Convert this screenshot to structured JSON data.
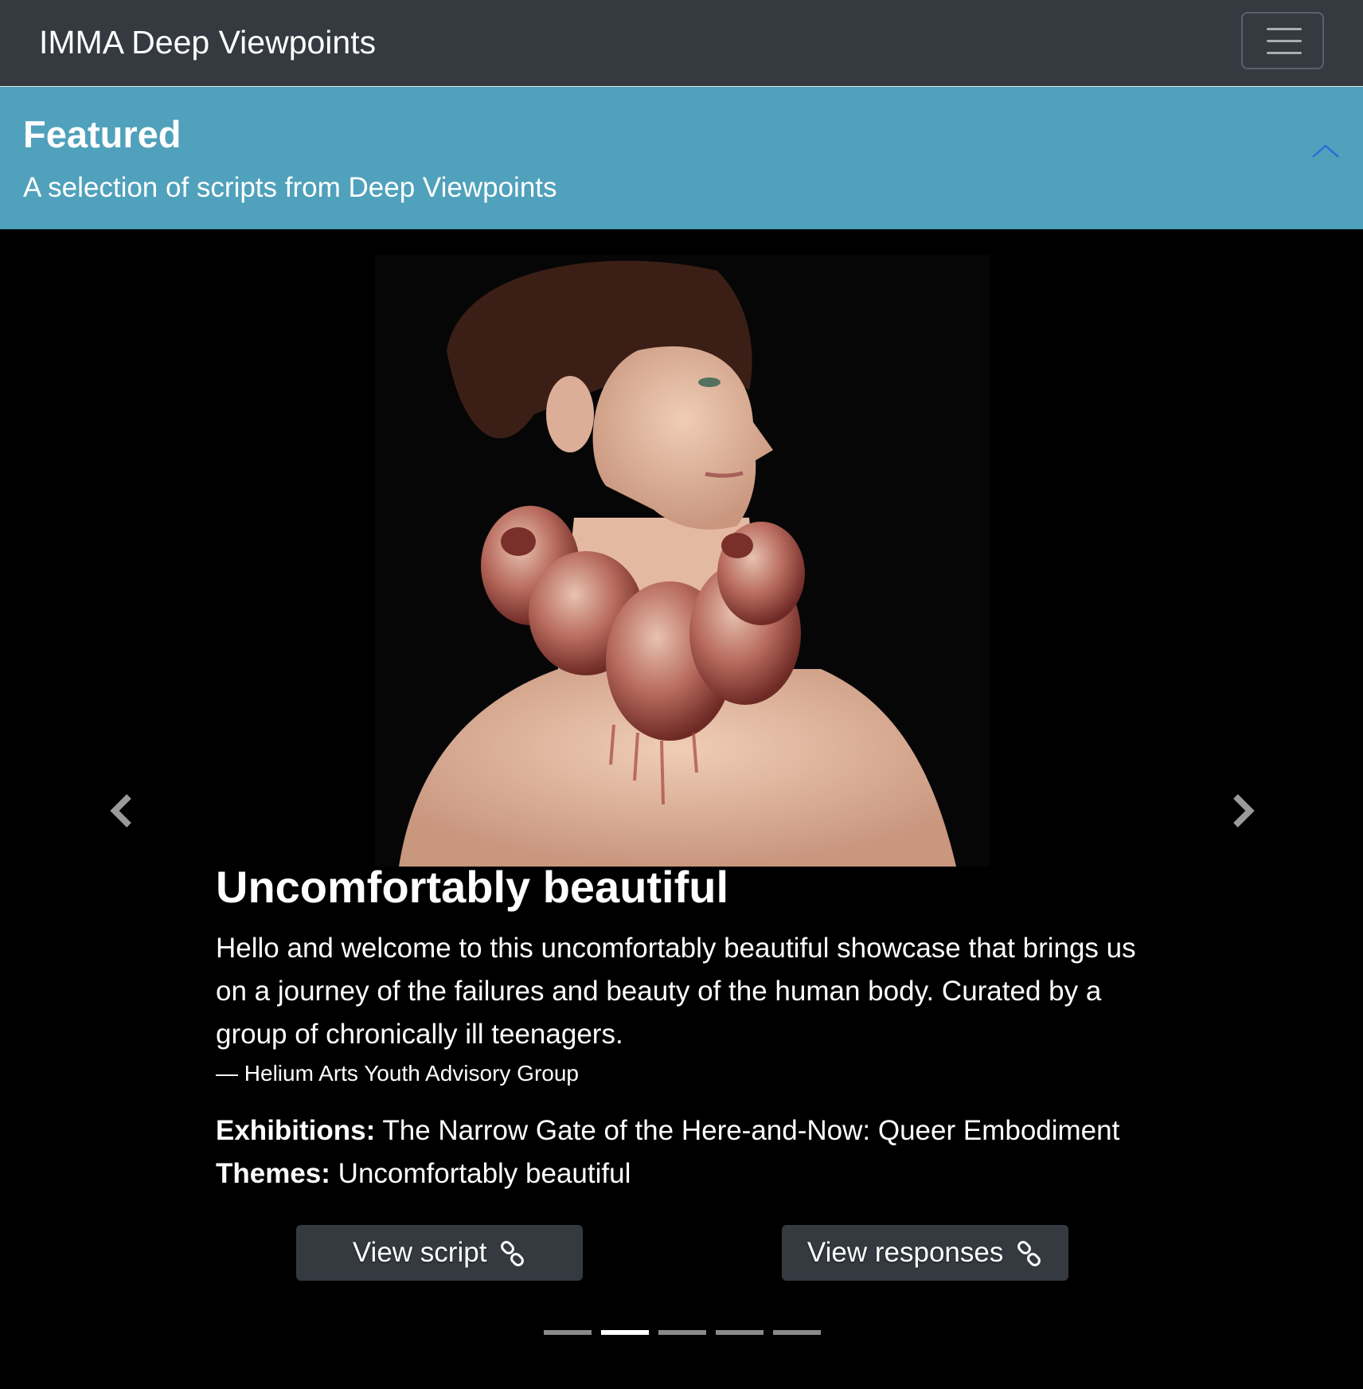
{
  "navbar": {
    "brand": "IMMA Deep Viewpoints",
    "menu_icon": "hamburger-menu-icon"
  },
  "featured": {
    "title": "Featured",
    "subtitle": "A selection of scripts from Deep Viewpoints",
    "collapse_icon": "chevron-up-icon",
    "collapse_color": "#2a6fdb"
  },
  "carousel": {
    "image_description_icon": "artwork-photo",
    "prev_icon": "chevron-left-icon",
    "next_icon": "chevron-right-icon",
    "slide": {
      "title": "Uncomfortably beautiful",
      "description": "Hello and welcome to this uncomfortably beautiful showcase that brings us on a journey of the failures and beauty of the human body. Curated by a group of chronically ill teenagers.",
      "author": "— Helium Arts Youth Advisory Group",
      "exhibitions_label": "Exhibitions:",
      "exhibitions_value": "The Narrow Gate of the Here-and-Now: Queer Embodiment",
      "themes_label": "Themes:",
      "themes_value": "Uncomfortably beautiful",
      "view_script_label": "View script",
      "view_responses_label": "View responses",
      "link_icon": "link-icon"
    },
    "indicators": {
      "count": 5,
      "active_index": 1
    }
  },
  "colors": {
    "navbar_bg": "#343a40",
    "featured_bg": "#50a1bb",
    "carousel_bg": "#000000",
    "button_bg": "#343a40"
  }
}
